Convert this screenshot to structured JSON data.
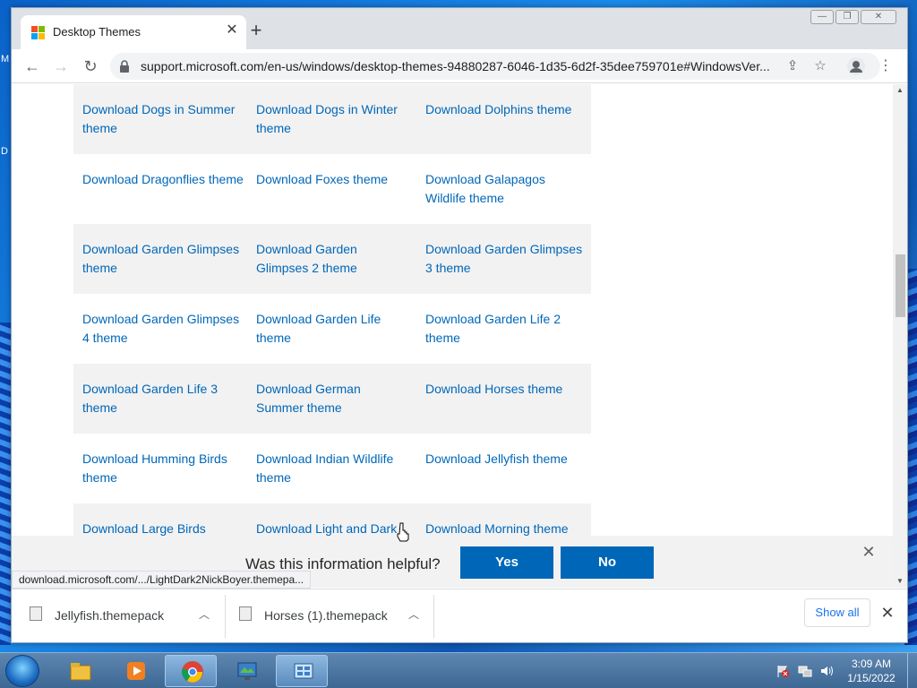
{
  "desktop": {
    "left_letters": [
      "M",
      "D"
    ]
  },
  "browser": {
    "tab": {
      "title": "Desktop Themes"
    },
    "url": "support.microsoft.com/en-us/windows/desktop-themes-94880287-6046-1d35-6d2f-35dee759701e#WindowsVer...",
    "window_buttons": {
      "minimize": "—",
      "maximize": "❐",
      "close": "✕"
    }
  },
  "themes": [
    [
      "Download Dogs in Summer theme",
      "Download Dogs in Winter theme",
      "Download Dolphins theme"
    ],
    [
      "Download Dragonflies theme",
      "Download Foxes theme",
      "Download Galapagos Wildlife theme"
    ],
    [
      "Download Garden Glimpses theme",
      "Download Garden Glimpses 2 theme",
      "Download Garden Glimpses 3 theme"
    ],
    [
      "Download Garden Glimpses 4 theme",
      "Download Garden Life theme",
      "Download Garden Life 2 theme"
    ],
    [
      "Download Garden Life 3 theme",
      "Download German Summer theme",
      "Download Horses theme"
    ],
    [
      "Download Humming Birds theme",
      "Download Indian Wildlife theme",
      "Download Jellyfish theme"
    ],
    [
      "Download Large Birds",
      "Download Light and Dark",
      "Download Morning theme"
    ]
  ],
  "feedback": {
    "question": "Was this information helpful?",
    "yes": "Yes",
    "no": "No"
  },
  "status_tip": "download.microsoft.com/.../LightDark2NickBoyer.themepa...",
  "downloads": {
    "items": [
      {
        "name": "Jellyfish.themepack"
      },
      {
        "name": "Horses (1).themepack"
      }
    ],
    "show_all": "Show all"
  },
  "taskbar": {
    "time": "3:09 AM",
    "date": "1/15/2022"
  },
  "colors": {
    "link": "#0067b8",
    "button": "#0067b8",
    "shade_row": "#f2f2f2"
  }
}
